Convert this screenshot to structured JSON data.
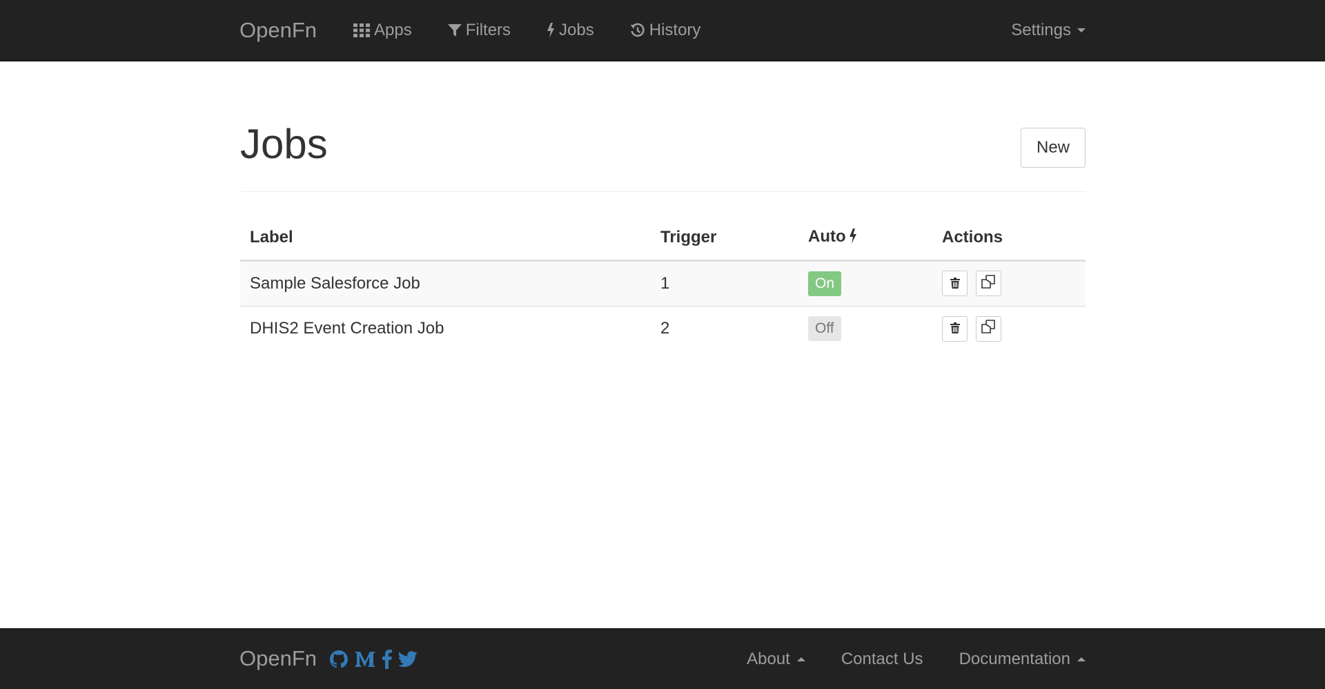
{
  "navbar": {
    "brand": "OpenFn",
    "items": [
      {
        "label": "Apps",
        "icon": "grid-icon"
      },
      {
        "label": "Filters",
        "icon": "filter-icon"
      },
      {
        "label": "Jobs",
        "icon": "bolt-icon"
      },
      {
        "label": "History",
        "icon": "history-icon"
      }
    ],
    "settings_label": "Settings"
  },
  "page": {
    "title": "Jobs",
    "new_button_label": "New"
  },
  "table": {
    "headers": {
      "label": "Label",
      "trigger": "Trigger",
      "auto": "Auto",
      "actions": "Actions"
    },
    "rows": [
      {
        "label": "Sample Salesforce Job",
        "trigger": "1",
        "auto": "On"
      },
      {
        "label": "DHIS2 Event Creation Job",
        "trigger": "2",
        "auto": "Off"
      }
    ]
  },
  "footer": {
    "brand": "OpenFn",
    "social_icons": [
      "github-icon",
      "medium-icon",
      "facebook-icon",
      "twitter-icon"
    ],
    "links": {
      "about": "About",
      "contact": "Contact Us",
      "documentation": "Documentation"
    }
  },
  "colors": {
    "navbar_bg": "#222222",
    "nav_text": "#9d9d9d",
    "social_blue": "#337ab7",
    "toggle_on": "#5cb85c",
    "toggle_off": "#e6e6e6"
  }
}
